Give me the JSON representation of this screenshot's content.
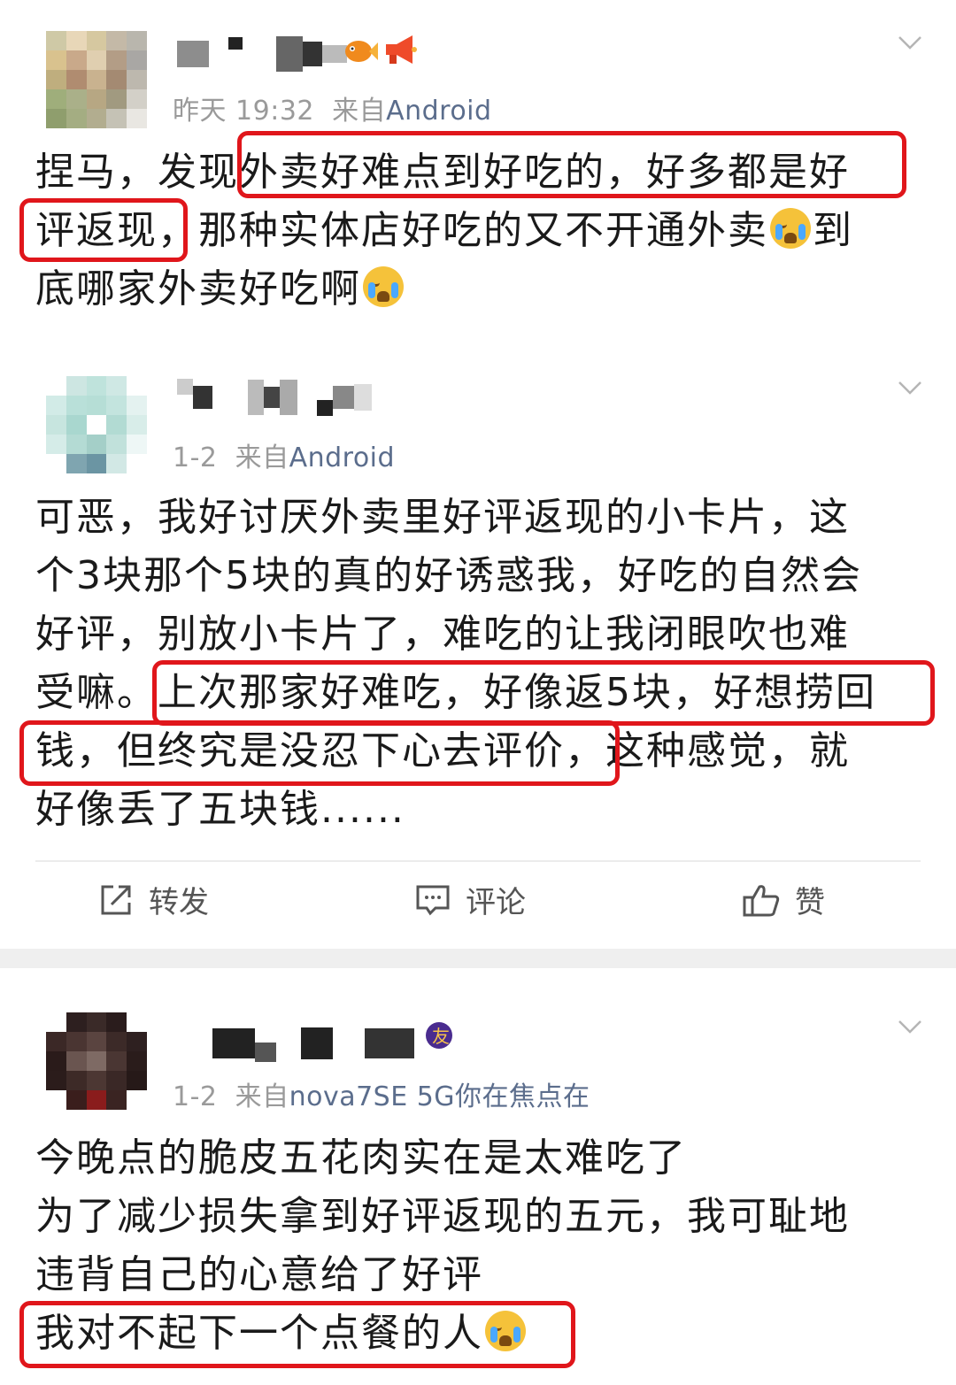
{
  "posts": [
    {
      "time": "昨天 19:32",
      "from_label": "来自",
      "source": "Android",
      "lines": [
        "捏马，发现外卖好难点到好吃的，好多都是好",
        "评返现，那种实体店好吃的又不开通外卖",
        "底哪家外卖好吃啊"
      ],
      "line2_tail": "到"
    },
    {
      "time": "1-2",
      "from_label": "来自",
      "source": "Android",
      "lines": [
        "可恶，我好讨厌外卖里好评返现的小卡片，这",
        "个3块那个5块的真的好诱惑我，好吃的自然会",
        "好评，别放小卡片了，难吃的让我闭眼吹也难",
        "受嘛。上次那家好难吃，好像返5块，好想捞回",
        "钱，但终究是没忍下心去评价，这种感觉，就",
        "好像丢了五块钱......"
      ]
    },
    {
      "time": "1-2",
      "from_label": "来自",
      "source": "nova7SE 5G你在焦点在",
      "lines": [
        "今晚点的脆皮五花肉实在是太难吃了",
        "为了减少损失拿到好评返现的五元，我可耻地",
        "违背自己的心意给了好评",
        "我对不起下一个点餐的人"
      ]
    }
  ],
  "actions": {
    "repost": "转发",
    "comment": "评论",
    "like": "赞"
  },
  "colors": {
    "highlight": "#e0161b",
    "source_link": "#5b6d8c",
    "meta": "#9a9a9a"
  }
}
